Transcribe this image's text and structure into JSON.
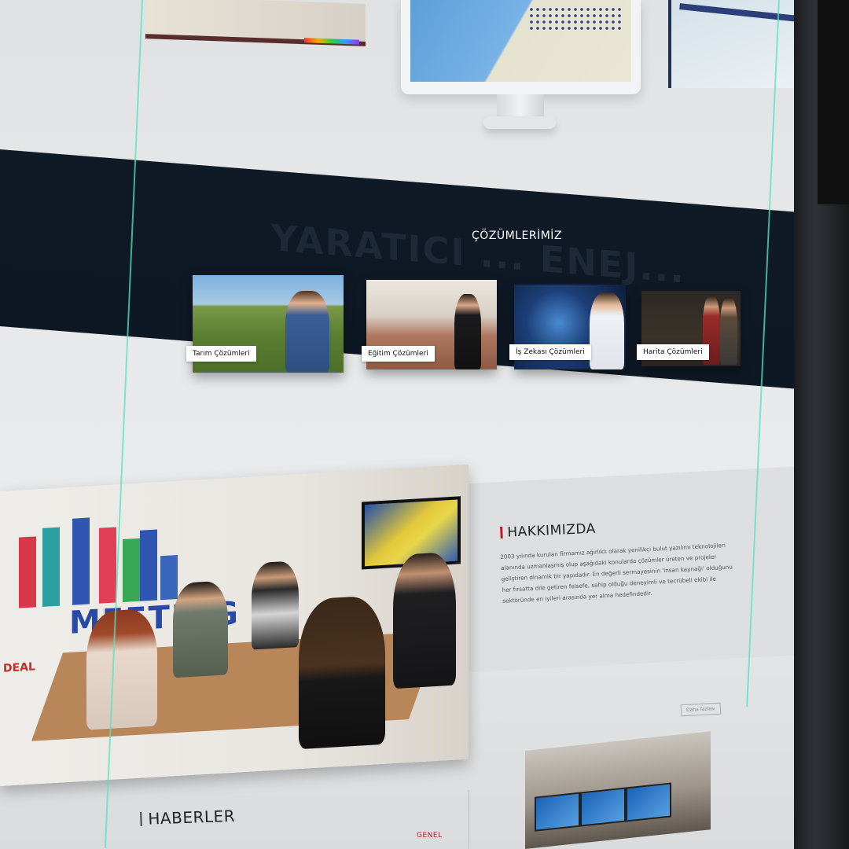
{
  "solutions": {
    "watermark": "YARATICI ... ENEJ...",
    "title": "ÇÖZÜMLERİMİZ",
    "items": [
      {
        "label": "Tarım Çözümleri"
      },
      {
        "label": "Eğitim Çözümleri"
      },
      {
        "label": "İş Zekası Çözümleri"
      },
      {
        "label": "Harita Çözümleri"
      }
    ]
  },
  "about": {
    "title": "HAKKIMIZDA",
    "text": "2003 yılında kurulan firmamız ağırlıklı olarak yenilikçi bulut yazılımı teknolojileri alanında uzmanlaşmış olup aşağıdaki konularda çözümler üreten ve projeler geliştiren dinamik bir yapıdadır. En değerli sermayesinin 'insan kaynağı' olduğunu her fırsatta dile getiren felsefe, sahip olduğu deneyimli ve tecrübeli ekibi ile sektöründe en iyileri arasında yer alma hedefindedir.",
    "read_more": "Daha fazlası",
    "photo_words": {
      "meeting": "MEETING",
      "deal": "DEAL"
    }
  },
  "news": {
    "title": "HABERLER",
    "category": "GENEL"
  },
  "colors": {
    "band": "#0f1925",
    "accent": "#b21f2d",
    "guide": "#5ae1be"
  }
}
